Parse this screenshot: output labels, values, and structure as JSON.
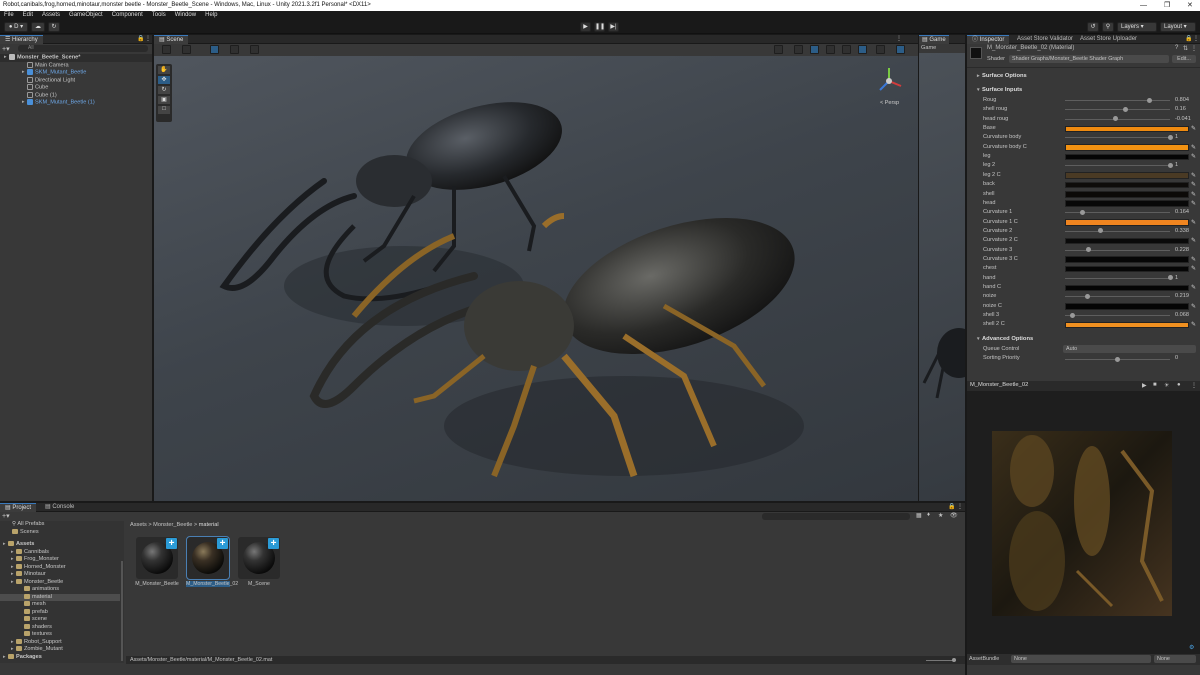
{
  "window": {
    "title": "Robot,canibals,frog,horned,minotaur,monster beetle - Monster_Beetle_Scene - Windows, Mac, Linux - Unity 2021.3.2f1 Personal* <DX11>"
  },
  "menu": [
    "File",
    "Edit",
    "Assets",
    "GameObject",
    "Component",
    "Tools",
    "Window",
    "Help"
  ],
  "toolbar": {
    "account": "D",
    "layers": "Layers",
    "layout": "Layout"
  },
  "hierarchy": {
    "tab": "Hierarchy",
    "search_placeholder": "All",
    "items": [
      {
        "label": "Monster_Beetle_Scene*",
        "depth": 0,
        "type": "scene"
      },
      {
        "label": "Main Camera",
        "depth": 1,
        "type": "go"
      },
      {
        "label": "SKM_Mutant_Beetle",
        "depth": 1,
        "type": "prefab"
      },
      {
        "label": "Directional Light",
        "depth": 1,
        "type": "go"
      },
      {
        "label": "Cube",
        "depth": 1,
        "type": "go"
      },
      {
        "label": "Cube (1)",
        "depth": 1,
        "type": "go"
      },
      {
        "label": "SKM_Mutant_Beetle (1)",
        "depth": 1,
        "type": "prefab"
      }
    ]
  },
  "scene": {
    "tab": "Scene",
    "persp_label": "< Persp",
    "game_tab": "Game",
    "game_dropdown": "Game"
  },
  "inspector": {
    "tabs": [
      "Inspector",
      "Asset Store Validator",
      "Asset Store Uploader"
    ],
    "material_name": "M_Monster_Beetle_02 (Material)",
    "shader_label": "Shader",
    "shader_value": "Shader Graphs/Monster_Beetle Shader Graph",
    "edit_label": "Edit...",
    "surface_options": "Surface Options",
    "surface_inputs": "Surface Inputs",
    "advanced_options": "Advanced Options",
    "properties": [
      {
        "name": "Roug",
        "kind": "slider",
        "value": "0.804",
        "frac": 0.804
      },
      {
        "name": "shell roug",
        "kind": "slider",
        "value": "0.16",
        "frac": 0.58
      },
      {
        "name": "head roug",
        "kind": "slider",
        "value": "-0.041",
        "frac": 0.48
      },
      {
        "name": "Base",
        "kind": "color",
        "color": "#ee8a10"
      },
      {
        "name": "Curvature body",
        "kind": "slider",
        "value": "1",
        "frac": 1.0
      },
      {
        "name": "Curvature body C",
        "kind": "color",
        "color": "#f29212"
      },
      {
        "name": "leg",
        "kind": "color",
        "color": "#050505"
      },
      {
        "name": "leg 2",
        "kind": "slider",
        "value": "1",
        "frac": 1.0
      },
      {
        "name": "leg 2 C",
        "kind": "color",
        "color": "#4a3a24"
      },
      {
        "name": "back",
        "kind": "color",
        "color": "#0e0c0a"
      },
      {
        "name": "shell",
        "kind": "color",
        "color": "#0c0a08"
      },
      {
        "name": "head",
        "kind": "color",
        "color": "#080808"
      },
      {
        "name": "Curvature 1",
        "kind": "slider",
        "value": "0.164",
        "frac": 0.164
      },
      {
        "name": "Curvature 1 C",
        "kind": "color",
        "color": "#f08520"
      },
      {
        "name": "Curvature 2",
        "kind": "slider",
        "value": "0.338",
        "frac": 0.338
      },
      {
        "name": "Curvature 2 C",
        "kind": "color",
        "color": "#0a0a0a"
      },
      {
        "name": "Curvature 3",
        "kind": "slider",
        "value": "0.228",
        "frac": 0.228
      },
      {
        "name": "Curvature 3 C",
        "kind": "color",
        "color": "#060606"
      },
      {
        "name": "chest",
        "kind": "color",
        "color": "#060606"
      },
      {
        "name": "hand",
        "kind": "slider",
        "value": "1",
        "frac": 1.0
      },
      {
        "name": "hand C",
        "kind": "color",
        "color": "#050505"
      },
      {
        "name": "noize",
        "kind": "slider",
        "value": "0.219",
        "frac": 0.219
      },
      {
        "name": "noize C",
        "kind": "color",
        "color": "#050505"
      },
      {
        "name": "shell 3",
        "kind": "slider",
        "value": "0.068",
        "frac": 0.068
      },
      {
        "name": "shell 2 C",
        "kind": "color",
        "color": "#f09020"
      }
    ],
    "queue_control_label": "Queue Control",
    "queue_control_value": "Auto",
    "sorting_priority_label": "Sorting Priority",
    "sorting_priority_value": "0",
    "preview_name": "M_Monster_Beetle_02",
    "assetbundle_label": "AssetBundle",
    "assetbundle_value": "None",
    "assetbundle_variant": "None"
  },
  "project": {
    "tabs": [
      "Project",
      "Console"
    ],
    "favorites": [
      "All Prefabs",
      "Scenes"
    ],
    "tree": [
      {
        "label": "Assets",
        "depth": 0,
        "bold": true
      },
      {
        "label": "Cannibals",
        "depth": 1
      },
      {
        "label": "Frog_Monster",
        "depth": 1
      },
      {
        "label": "Horned_Monster",
        "depth": 1
      },
      {
        "label": "Minotaur",
        "depth": 1
      },
      {
        "label": "Monster_Beetle",
        "depth": 1
      },
      {
        "label": "animations",
        "depth": 2
      },
      {
        "label": "material",
        "depth": 2,
        "selected": true
      },
      {
        "label": "mesh",
        "depth": 2
      },
      {
        "label": "prefab",
        "depth": 2
      },
      {
        "label": "scene",
        "depth": 2
      },
      {
        "label": "shaders",
        "depth": 2
      },
      {
        "label": "textures",
        "depth": 2
      },
      {
        "label": "Robot_Support",
        "depth": 1
      },
      {
        "label": "Zombie_Mutant",
        "depth": 1
      },
      {
        "label": "Packages",
        "depth": 0,
        "bold": true
      }
    ],
    "breadcrumb": [
      "Assets",
      "Monster_Beetle",
      "material"
    ],
    "assets": [
      "M_Monster_Beetle",
      "M_Monster_Beetle_02",
      "M_Scene"
    ],
    "status_path": "Assets/Monster_Beetle/material/M_Monster_Beetle_02.mat"
  }
}
